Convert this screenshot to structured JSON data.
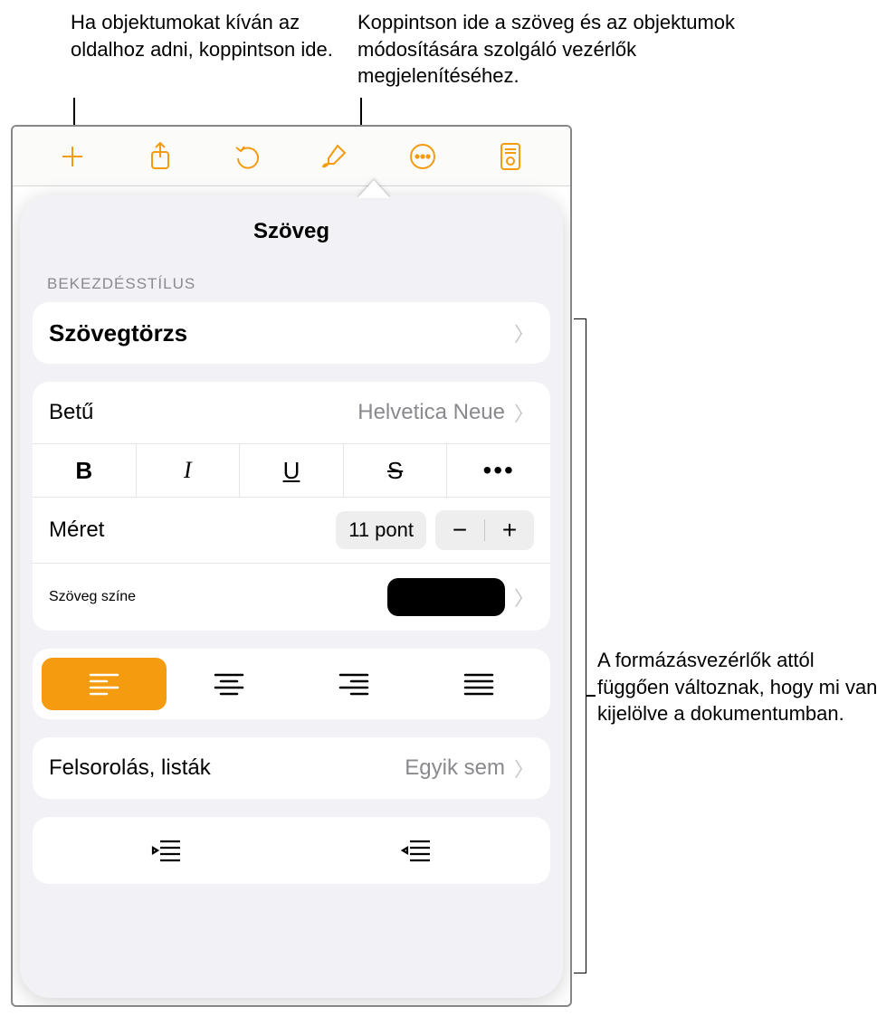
{
  "callouts": {
    "add": "Ha objektumokat kíván az oldalhoz adni, koppintson ide.",
    "format": "Koppintson ide a szöveg és az objektumok módosítására szolgáló vezérlők megjelenítéséhez.",
    "controls": "A formázásvezérlők attól függően változnak, hogy mi van kijelölve a dokumentumban."
  },
  "toolbar": {
    "add": "add-icon",
    "share": "share-icon",
    "undo": "undo-icon",
    "format": "format-brush-icon",
    "more": "more-icon",
    "document": "document-icon"
  },
  "panel": {
    "title": "Szöveg",
    "paragraph_section": "BEKEZDÉSSTÍLUS",
    "paragraph_style": "Szövegtörzs",
    "font_label": "Betű",
    "font_value": "Helvetica Neue",
    "style_buttons": {
      "bold": "B",
      "italic": "I",
      "underline": "U",
      "strike": "S",
      "more": "•••"
    },
    "size_label": "Méret",
    "size_value": "11 pont",
    "color_label": "Szöveg színe",
    "color_value": "#000000",
    "alignment_active": "left",
    "lists_label": "Felsorolás, listák",
    "lists_value": "Egyik sem"
  }
}
